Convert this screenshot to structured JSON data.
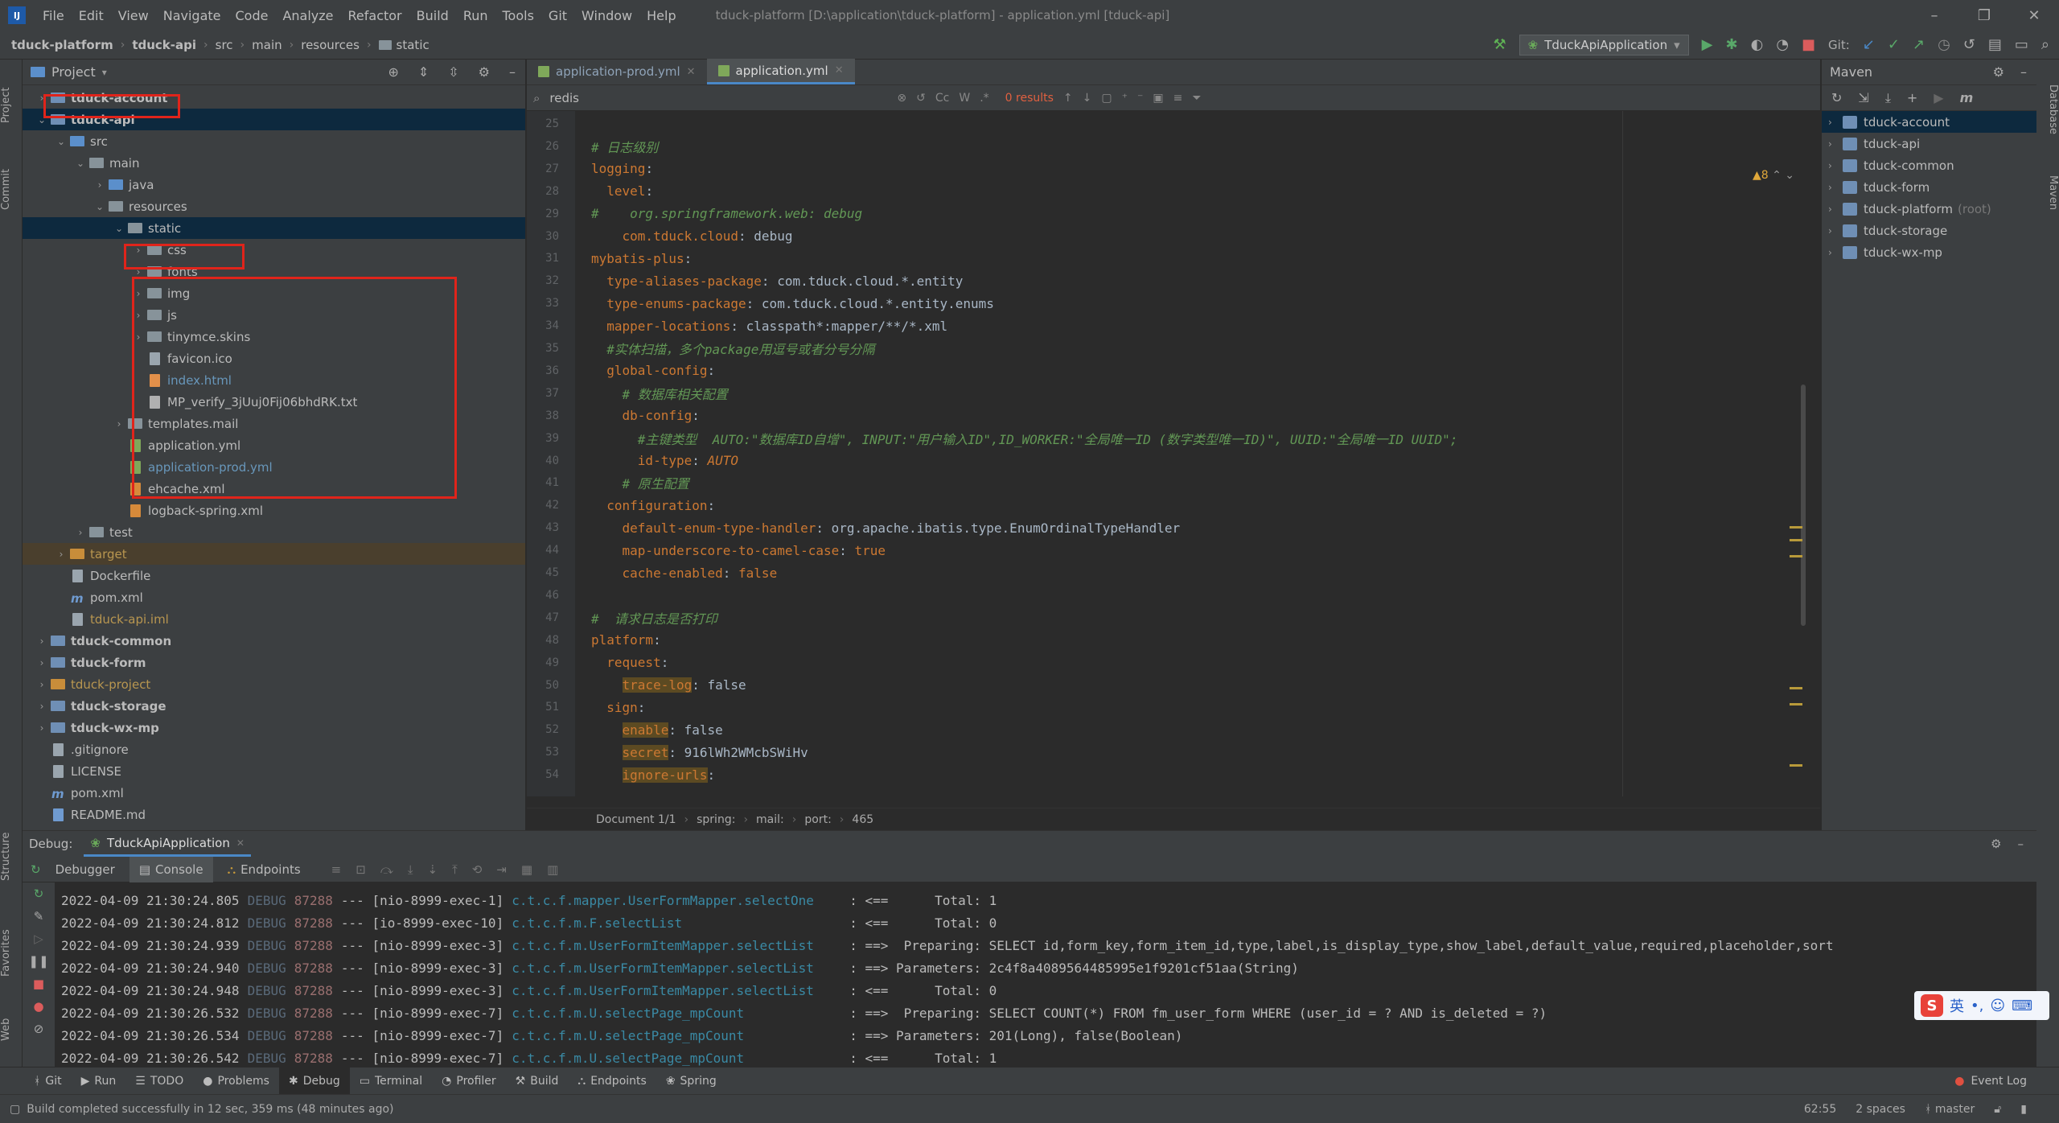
{
  "menubar": {
    "items": [
      "File",
      "Edit",
      "View",
      "Navigate",
      "Code",
      "Analyze",
      "Refactor",
      "Build",
      "Run",
      "Tools",
      "Git",
      "Window",
      "Help"
    ],
    "title": "tduck-platform [D:\\application\\tduck-platform] - application.yml [tduck-api]"
  },
  "breadcrumb": [
    "tduck-platform",
    "tduck-api",
    "src",
    "main",
    "resources",
    "static"
  ],
  "run_config": "TduckApiApplication",
  "git_label": "Git:",
  "project_pane": {
    "title": "Project",
    "tree": [
      {
        "indent": 0,
        "arrow": "›",
        "icon": "module",
        "label": "tduck-account",
        "style": "bold"
      },
      {
        "indent": 0,
        "arrow": "⌄",
        "icon": "module",
        "label": "tduck-api",
        "style": "bold",
        "selected": true
      },
      {
        "indent": 1,
        "arrow": "⌄",
        "icon": "src",
        "label": "src",
        "style": ""
      },
      {
        "indent": 2,
        "arrow": "⌄",
        "icon": "folder",
        "label": "main",
        "style": ""
      },
      {
        "indent": 3,
        "arrow": "›",
        "icon": "src",
        "label": "java",
        "style": ""
      },
      {
        "indent": 3,
        "arrow": "⌄",
        "icon": "folder",
        "label": "resources",
        "style": ""
      },
      {
        "indent": 4,
        "arrow": "⌄",
        "icon": "folder",
        "label": "static",
        "style": "",
        "selected": true
      },
      {
        "indent": 5,
        "arrow": "›",
        "icon": "folder",
        "label": "css",
        "style": ""
      },
      {
        "indent": 5,
        "arrow": "›",
        "icon": "folder",
        "label": "fonts",
        "style": ""
      },
      {
        "indent": 5,
        "arrow": "›",
        "icon": "folder",
        "label": "img",
        "style": ""
      },
      {
        "indent": 5,
        "arrow": "›",
        "icon": "folder",
        "label": "js",
        "style": ""
      },
      {
        "indent": 5,
        "arrow": "›",
        "icon": "folder",
        "label": "tinymce.skins",
        "style": ""
      },
      {
        "indent": 5,
        "arrow": "",
        "icon": "file",
        "label": "favicon.ico",
        "style": ""
      },
      {
        "indent": 5,
        "arrow": "",
        "icon": "html",
        "label": "index.html",
        "style": "blue"
      },
      {
        "indent": 5,
        "arrow": "",
        "icon": "txt",
        "label": "MP_verify_3jUuj0Fij06bhdRK.txt",
        "style": ""
      },
      {
        "indent": 4,
        "arrow": "›",
        "icon": "folder",
        "label": "templates.mail",
        "style": ""
      },
      {
        "indent": 4,
        "arrow": "",
        "icon": "yml",
        "label": "application.yml",
        "style": ""
      },
      {
        "indent": 4,
        "arrow": "",
        "icon": "yml",
        "label": "application-prod.yml",
        "style": "blue"
      },
      {
        "indent": 4,
        "arrow": "",
        "icon": "xml",
        "label": "ehcache.xml",
        "style": ""
      },
      {
        "indent": 4,
        "arrow": "",
        "icon": "xml",
        "label": "logback-spring.xml",
        "style": ""
      },
      {
        "indent": 2,
        "arrow": "›",
        "icon": "folder",
        "label": "test",
        "style": ""
      },
      {
        "indent": 1,
        "arrow": "›",
        "icon": "orange",
        "label": "target",
        "style": "orange",
        "target": true
      },
      {
        "indent": 1,
        "arrow": "",
        "icon": "file",
        "label": "Dockerfile",
        "style": ""
      },
      {
        "indent": 1,
        "arrow": "",
        "icon": "maven",
        "label": "pom.xml",
        "style": ""
      },
      {
        "indent": 1,
        "arrow": "",
        "icon": "file",
        "label": "tduck-api.iml",
        "style": "orange"
      },
      {
        "indent": 0,
        "arrow": "›",
        "icon": "module",
        "label": "tduck-common",
        "style": "bold"
      },
      {
        "indent": 0,
        "arrow": "›",
        "icon": "module",
        "label": "tduck-form",
        "style": "bold"
      },
      {
        "indent": 0,
        "arrow": "›",
        "icon": "orange",
        "label": "tduck-project",
        "style": "orange"
      },
      {
        "indent": 0,
        "arrow": "›",
        "icon": "module",
        "label": "tduck-storage",
        "style": "bold"
      },
      {
        "indent": 0,
        "arrow": "›",
        "icon": "module",
        "label": "tduck-wx-mp",
        "style": "bold"
      },
      {
        "indent": 0,
        "arrow": "",
        "icon": "file",
        "label": ".gitignore",
        "style": ""
      },
      {
        "indent": 0,
        "arrow": "",
        "icon": "file",
        "label": "LICENSE",
        "style": ""
      },
      {
        "indent": 0,
        "arrow": "",
        "icon": "maven",
        "label": "pom.xml",
        "style": ""
      },
      {
        "indent": 0,
        "arrow": "",
        "icon": "md",
        "label": "README.md",
        "style": ""
      }
    ]
  },
  "editor": {
    "tabs": [
      {
        "label": "application-prod.yml",
        "active": false
      },
      {
        "label": "application.yml",
        "active": true
      }
    ],
    "search": {
      "value": "redis",
      "results": "0 results",
      "options": [
        "Cc",
        "W",
        ".*"
      ]
    },
    "warnings": "▲8",
    "lines": [
      {
        "n": "25",
        "html": ""
      },
      {
        "n": "26",
        "html": "<span class='c'># 日志级别</span>"
      },
      {
        "n": "27",
        "html": "<span class='k'>logging</span><span class='v'>:</span>"
      },
      {
        "n": "28",
        "html": "  <span class='k'>level</span><span class='v'>:</span>"
      },
      {
        "n": "29",
        "html": "<span class='c'>#    org.springframework.web: debug</span>"
      },
      {
        "n": "30",
        "html": "    <span class='k'>com.tduck.cloud</span><span class='v'>: debug</span>"
      },
      {
        "n": "31",
        "html": "<span class='k'>mybatis-plus</span><span class='v'>:</span>"
      },
      {
        "n": "32",
        "html": "  <span class='k'>type-aliases-package</span><span class='v'>: com.tduck.cloud.*.entity</span>"
      },
      {
        "n": "33",
        "html": "  <span class='k'>type-enums-package</span><span class='v'>: com.tduck.cloud.*.entity.enums</span>"
      },
      {
        "n": "34",
        "html": "  <span class='k'>mapper-locations</span><span class='v'>: classpath*:mapper/**/*.xml</span>"
      },
      {
        "n": "35",
        "html": "  <span class='c'>#实体扫描，多个package用逗号或者分号分隔</span>"
      },
      {
        "n": "36",
        "html": "  <span class='k'>global-config</span><span class='v'>:</span>"
      },
      {
        "n": "37",
        "html": "    <span class='c'># 数据库相关配置</span>"
      },
      {
        "n": "38",
        "html": "    <span class='k'>db-config</span><span class='v'>:</span>"
      },
      {
        "n": "39",
        "html": "      <span class='c'>#主键类型  AUTO:\"数据库ID自增\", INPUT:\"用户输入ID\",ID_WORKER:\"全局唯一ID (数字类型唯一ID)\", UUID:\"全局唯一ID UUID\";</span>"
      },
      {
        "n": "40",
        "html": "      <span class='k'>id-type</span><span class='v'>: </span><span class='bool' style='font-style:italic'>AUTO</span>"
      },
      {
        "n": "41",
        "html": "    <span class='c'># 原生配置</span>"
      },
      {
        "n": "42",
        "html": "  <span class='k'>configuration</span><span class='v'>:</span>"
      },
      {
        "n": "43",
        "html": "    <span class='k'>default-enum-type-handler</span><span class='v'>: org.apache.ibatis.type.EnumOrdinalTypeHandler</span>"
      },
      {
        "n": "44",
        "html": "    <span class='k'>map-underscore-to-camel-case</span><span class='v'>: </span><span class='bool'>true</span>"
      },
      {
        "n": "45",
        "html": "    <span class='k'>cache-enabled</span><span class='v'>: </span><span class='bool'>false</span>"
      },
      {
        "n": "46",
        "html": ""
      },
      {
        "n": "47",
        "html": "<span class='c'>#  请求日志是否打印</span>"
      },
      {
        "n": "48",
        "html": "<span class='k'>platform</span><span class='v'>:</span>"
      },
      {
        "n": "49",
        "html": "  <span class='k'>request</span><span class='v'>:</span>"
      },
      {
        "n": "50",
        "html": "    <span class='hl'>trace-log</span><span class='v'>: false</span>"
      },
      {
        "n": "51",
        "html": "  <span class='k'>sign</span><span class='v'>:</span>"
      },
      {
        "n": "52",
        "html": "    <span class='hl'>enable</span><span class='v'>: false</span>"
      },
      {
        "n": "53",
        "html": "    <span class='hl'>secret</span><span class='v'>: 916lWh2WMcbSWiHv</span>"
      },
      {
        "n": "54",
        "html": "    <span class='hl'>ignore-urls</span><span class='v'>:</span>"
      }
    ],
    "breadcrumb": [
      "Document 1/1",
      "spring:",
      "mail:",
      "port:",
      "465"
    ]
  },
  "maven_pane": {
    "title": "Maven",
    "items": [
      {
        "label": "tduck-account",
        "selected": true,
        "suffix": ""
      },
      {
        "label": "tduck-api",
        "selected": false,
        "suffix": ""
      },
      {
        "label": "tduck-common",
        "selected": false,
        "suffix": ""
      },
      {
        "label": "tduck-form",
        "selected": false,
        "suffix": ""
      },
      {
        "label": "tduck-platform",
        "selected": false,
        "suffix": "(root)"
      },
      {
        "label": "tduck-storage",
        "selected": false,
        "suffix": ""
      },
      {
        "label": "tduck-wx-mp",
        "selected": false,
        "suffix": ""
      }
    ]
  },
  "left_strip": [
    "Project",
    "Commit",
    "Structure",
    "Favorites",
    "Web"
  ],
  "right_strip": [
    "Database",
    "Maven"
  ],
  "debug": {
    "label": "Debug:",
    "session": "TduckApiApplication",
    "tabs": [
      "Debugger",
      "Console",
      "Endpoints"
    ],
    "log": [
      {
        "ts": "2022-04-09 21:30:24.805",
        "lvl": "DEBUG",
        "pid": "87288",
        "thread": "--- [nio-8999-exec-1]",
        "logger": "c.t.c.f.mapper.UserFormMapper.selectOne",
        "msg": ": <==      Total: 1"
      },
      {
        "ts": "2022-04-09 21:30:24.812",
        "lvl": "DEBUG",
        "pid": "87288",
        "thread": "--- [io-8999-exec-10]",
        "logger": "c.t.c.f.m.F.selectList",
        "msg": ": <==      Total: 0"
      },
      {
        "ts": "2022-04-09 21:30:24.939",
        "lvl": "DEBUG",
        "pid": "87288",
        "thread": "--- [nio-8999-exec-3]",
        "logger": "c.t.c.f.m.UserFormItemMapper.selectList",
        "msg": ": ==>  Preparing: SELECT id,form_key,form_item_id,type,label,is_display_type,show_label,default_value,required,placeholder,sort"
      },
      {
        "ts": "2022-04-09 21:30:24.940",
        "lvl": "DEBUG",
        "pid": "87288",
        "thread": "--- [nio-8999-exec-3]",
        "logger": "c.t.c.f.m.UserFormItemMapper.selectList",
        "msg": ": ==> Parameters: 2c4f8a4089564485995e1f9201cf51aa(String)"
      },
      {
        "ts": "2022-04-09 21:30:24.948",
        "lvl": "DEBUG",
        "pid": "87288",
        "thread": "--- [nio-8999-exec-3]",
        "logger": "c.t.c.f.m.UserFormItemMapper.selectList",
        "msg": ": <==      Total: 0"
      },
      {
        "ts": "2022-04-09 21:30:26.532",
        "lvl": "DEBUG",
        "pid": "87288",
        "thread": "--- [nio-8999-exec-7]",
        "logger": "c.t.c.f.m.U.selectPage_mpCount",
        "msg": ": ==>  Preparing: SELECT COUNT(*) FROM fm_user_form WHERE (user_id = ? AND is_deleted = ?)"
      },
      {
        "ts": "2022-04-09 21:30:26.534",
        "lvl": "DEBUG",
        "pid": "87288",
        "thread": "--- [nio-8999-exec-7]",
        "logger": "c.t.c.f.m.U.selectPage_mpCount",
        "msg": ": ==> Parameters: 201(Long), false(Boolean)"
      },
      {
        "ts": "2022-04-09 21:30:26.542",
        "lvl": "DEBUG",
        "pid": "87288",
        "thread": "--- [nio-8999-exec-7]",
        "logger": "c.t.c.f.m.U.selectPage_mpCount",
        "msg": ": <==      Total: 1"
      }
    ]
  },
  "ime": {
    "lang": "英"
  },
  "toolwindows": [
    "Git",
    "Run",
    "TODO",
    "Problems",
    "Debug",
    "Terminal",
    "Profiler",
    "Build",
    "Endpoints",
    "Spring"
  ],
  "event_log": "Event Log",
  "status": {
    "message": "Build completed successfully in 12 sec, 359 ms (48 minutes ago)",
    "position": "62:55",
    "indent": "2 spaces",
    "branch": "master"
  }
}
